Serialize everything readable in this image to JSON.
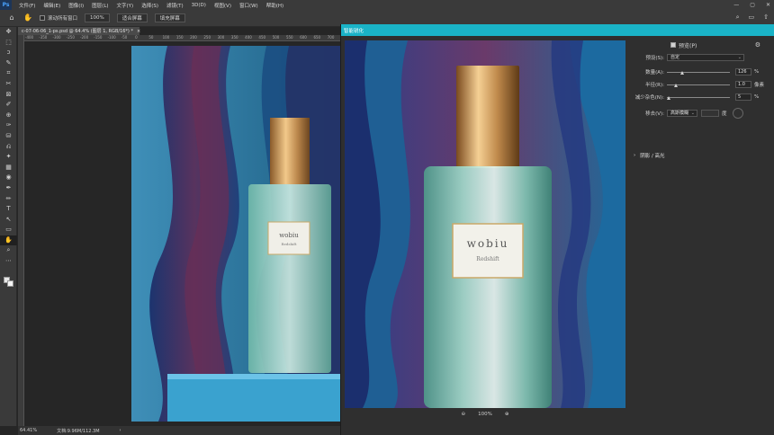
{
  "menubar": {
    "logo": "Ps",
    "items": [
      "文件(F)",
      "编辑(E)",
      "图像(I)",
      "图层(L)",
      "文字(Y)",
      "选择(S)",
      "滤镜(T)",
      "3D(D)",
      "视图(V)",
      "窗口(W)",
      "帮助(H)"
    ],
    "minimize": "—",
    "maximize": "▢",
    "close": "✕"
  },
  "options": {
    "home_icon": "⌂",
    "hand_icon": "✋",
    "scroll_all_windows": "滚动所有窗口",
    "zoom_100": "100%",
    "fit_screen": "适合屏幕",
    "fill_screen": "填充屏幕",
    "search_icon": "⌕",
    "layout_icon": "▭",
    "share_icon": "⇧"
  },
  "toolbar": {
    "tools": [
      "✥",
      "⬚",
      "ↄ",
      "✎",
      "⌗",
      "✂",
      "⊠",
      "✐",
      "⊕",
      "✑",
      "⛁",
      "⎌",
      "✦",
      "▦",
      "◉",
      "✒",
      "✏",
      "T",
      "↖",
      "▭",
      "✋",
      "⌕",
      "⋯"
    ],
    "active_index": 20
  },
  "document": {
    "tab_title": "c-07-06-06_1-ps.psd @ 64.4% (图层 1, RGB/16*) *",
    "tab_close": "×",
    "ruler_ticks": [
      "-400",
      "-350",
      "-300",
      "-250",
      "-200",
      "-150",
      "-100",
      "-50",
      "0",
      "50",
      "100",
      "150",
      "200",
      "250",
      "300",
      "350",
      "400",
      "450",
      "500",
      "550",
      "600",
      "650",
      "700"
    ]
  },
  "status": {
    "zoom": "64.41%",
    "doc_size": "文档:9.96M/112.3M",
    "arrow": "›"
  },
  "bottle": {
    "brand": "wobiu",
    "sub": "Redshift"
  },
  "dialog": {
    "title": "智能锐化",
    "preview_checkbox_label": "预览(P)",
    "preset_label": "预设(S):",
    "preset_value": "自定",
    "amount_label": "数量(A):",
    "amount_value": "126",
    "amount_unit": "%",
    "amount_fraction": 0.25,
    "radius_label": "半径(R):",
    "radius_value": "1.0",
    "radius_unit": "像素",
    "radius_fraction": 0.15,
    "reduce_noise_label": "减少杂色(N):",
    "reduce_noise_value": "5",
    "reduce_noise_unit": "%",
    "reduce_noise_fraction": 0.04,
    "remove_label": "移去(V):",
    "remove_value": "高斯模糊",
    "angle_unit": "度",
    "shadows_highlights": "阴影 / 高光",
    "zoom_out_icon": "⊖",
    "zoom_in_icon": "⊕",
    "zoom_level": "100%"
  }
}
